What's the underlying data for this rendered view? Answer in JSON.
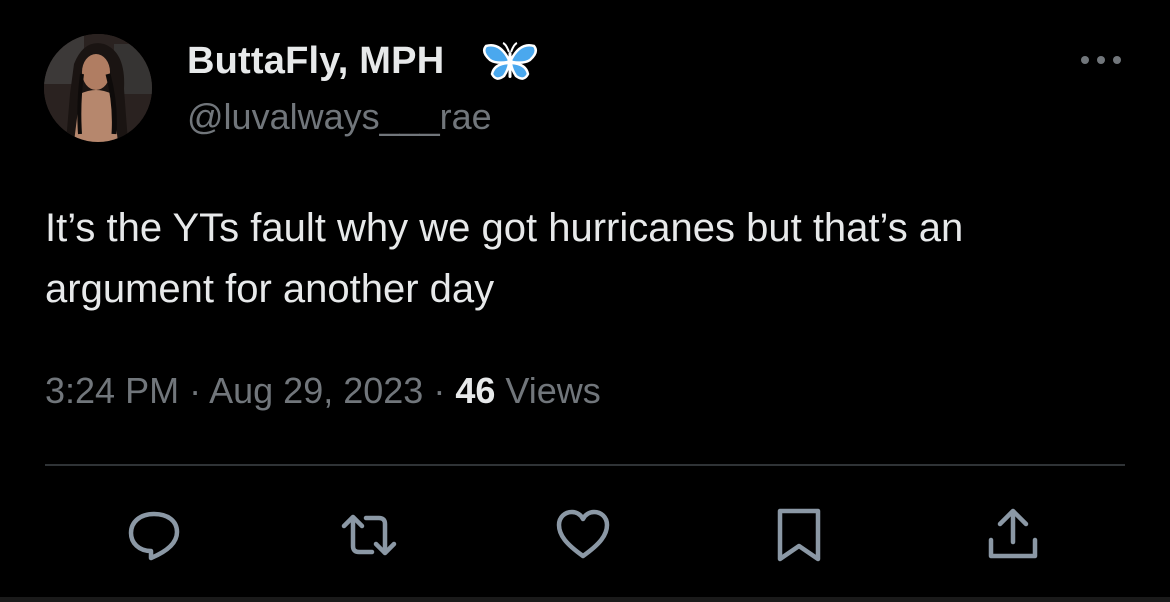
{
  "author": {
    "display_name": "ButtaFly, MPH",
    "handle": "@luvalways___rae",
    "badge_icon": "butterfly-icon",
    "badge_color": "#4aa8ee"
  },
  "tweet": {
    "text": "It’s the YTs fault why we got hurricanes but that’s an argument for another day",
    "time": "3:24 PM",
    "separator": "·",
    "date": "Aug 29, 2023",
    "views_count": "46",
    "views_label": "Views"
  },
  "actions": [
    {
      "name": "reply",
      "icon": "reply-icon"
    },
    {
      "name": "retweet",
      "icon": "retweet-icon"
    },
    {
      "name": "like",
      "icon": "heart-icon"
    },
    {
      "name": "bookmark",
      "icon": "bookmark-icon"
    },
    {
      "name": "share",
      "icon": "share-icon"
    }
  ],
  "colors": {
    "background": "#000000",
    "primary_text": "#e7e9ea",
    "secondary_text": "#71767b",
    "divider": "#2f3336"
  }
}
